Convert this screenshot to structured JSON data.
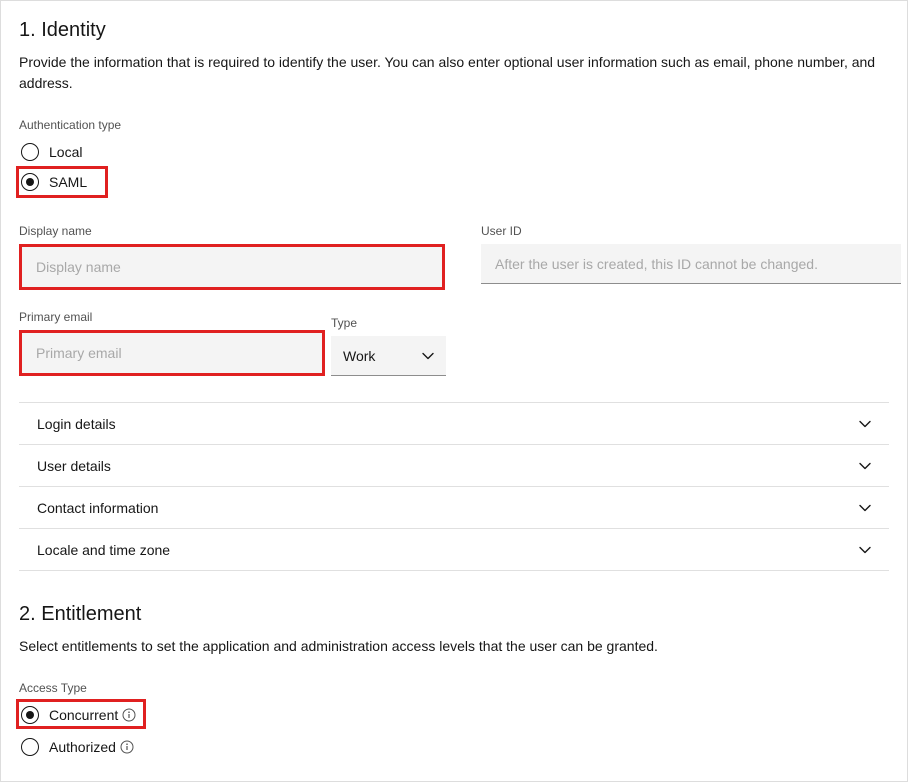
{
  "identity": {
    "title": "1. Identity",
    "description": "Provide the information that is required to identify the user. You can also enter optional user information such as email, phone number, and address.",
    "auth": {
      "label": "Authentication type",
      "options": [
        "Local",
        "SAML"
      ],
      "selected": "SAML"
    },
    "displayName": {
      "label": "Display name",
      "placeholder": "Display name",
      "value": ""
    },
    "userId": {
      "label": "User ID",
      "placeholder": "After the user is created, this ID cannot be changed.",
      "value": ""
    },
    "primaryEmail": {
      "label": "Primary email",
      "placeholder": "Primary email",
      "value": ""
    },
    "emailType": {
      "label": "Type",
      "value": "Work"
    },
    "accordion": [
      "Login details",
      "User details",
      "Contact information",
      "Locale and time zone"
    ]
  },
  "entitlement": {
    "title": "2. Entitlement",
    "description": "Select entitlements to set the application and administration access levels that the user can be granted.",
    "accessType": {
      "label": "Access Type",
      "options": [
        "Concurrent",
        "Authorized"
      ],
      "selected": "Concurrent"
    }
  }
}
